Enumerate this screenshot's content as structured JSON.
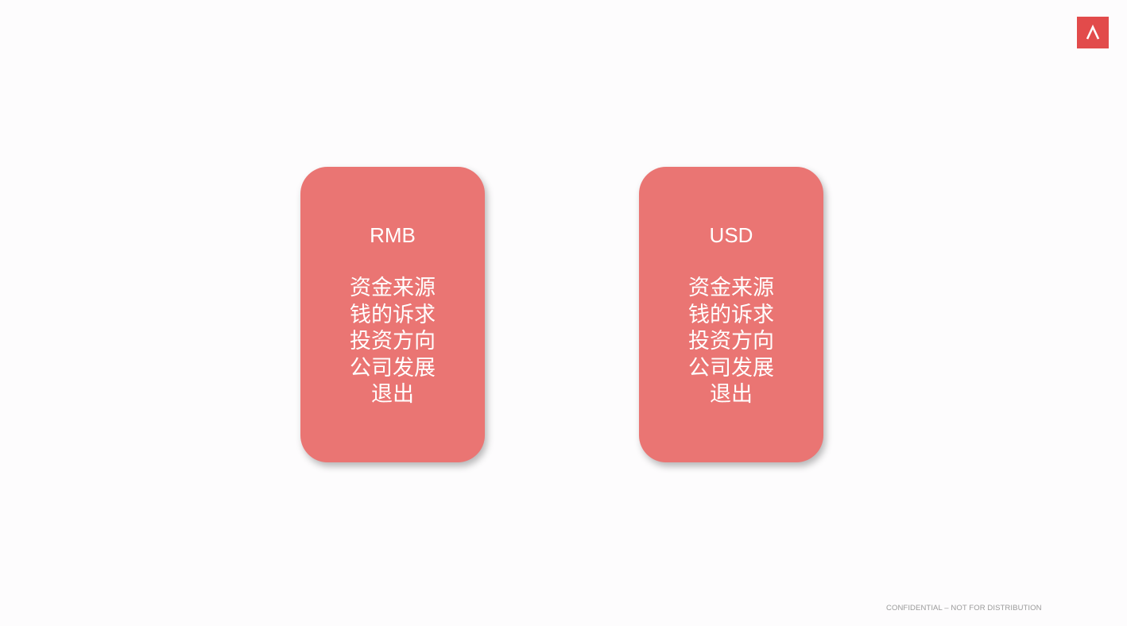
{
  "logo": {
    "icon": "caret-up-icon",
    "color": "#e24b4b"
  },
  "cards": [
    {
      "title": "RMB",
      "items": [
        "资金来源",
        "钱的诉求",
        "投资方向",
        "公司发展",
        "退出"
      ]
    },
    {
      "title": "USD",
      "items": [
        "资金来源",
        "钱的诉求",
        "投资方向",
        "公司发展",
        "退出"
      ]
    }
  ],
  "card_color": "#ea7573",
  "footer": {
    "text": "CONFIDENTIAL – NOT FOR DISTRIBUTION"
  }
}
